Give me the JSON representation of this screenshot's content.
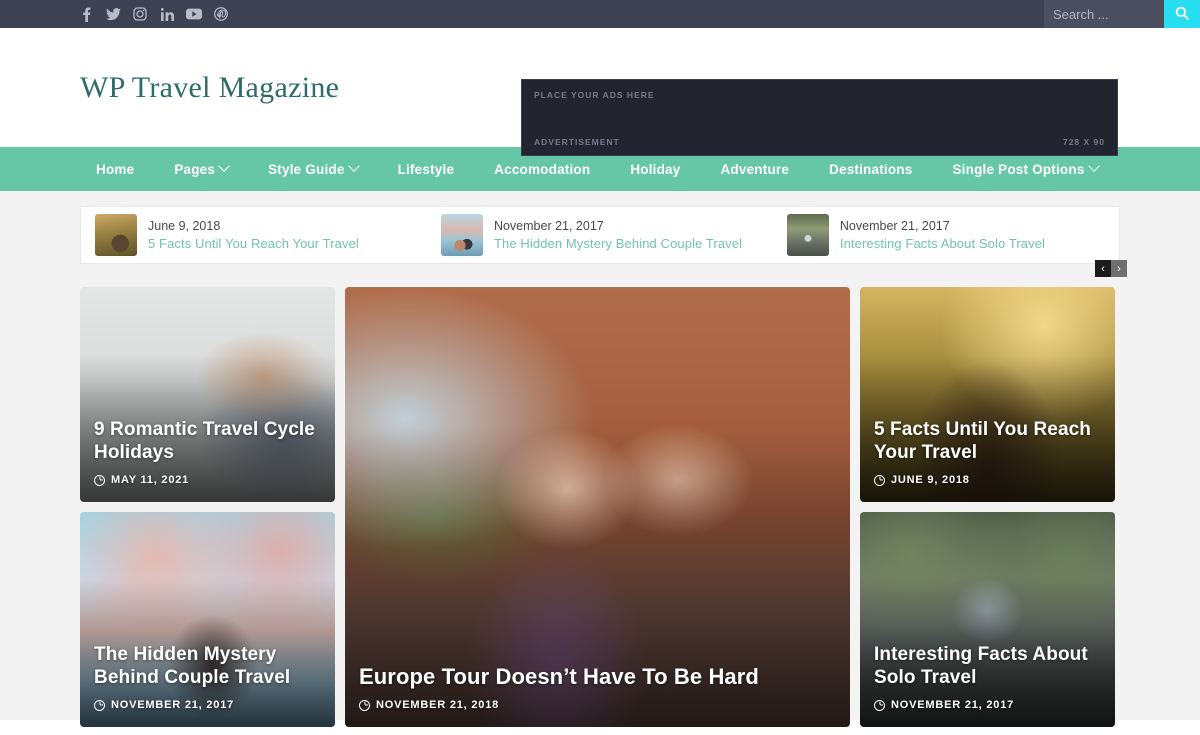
{
  "topbar": {
    "social": [
      {
        "name": "facebook-icon",
        "label": "Facebook"
      },
      {
        "name": "twitter-icon",
        "label": "Twitter"
      },
      {
        "name": "instagram-icon",
        "label": "Instagram"
      },
      {
        "name": "linkedin-icon",
        "label": "LinkedIn"
      },
      {
        "name": "youtube-icon",
        "label": "YouTube"
      },
      {
        "name": "pinterest-icon",
        "label": "Pinterest"
      }
    ],
    "search": {
      "placeholder": "Search ...",
      "value": "",
      "button_icon": "search-icon"
    },
    "background": "#3d4152",
    "search_button_color": "#27dff0"
  },
  "header": {
    "site_title": "WP Travel Magazine",
    "site_title_color": "#2e6b6a",
    "ad": {
      "top_label": "PLACE YOUR ADS HERE",
      "bottom_label": "ADVERTISEMENT",
      "size_label": "728 X 90"
    }
  },
  "nav": {
    "background": "#66c7a7",
    "items": [
      {
        "label": "Home",
        "has_dropdown": false
      },
      {
        "label": "Pages",
        "has_dropdown": true
      },
      {
        "label": "Style Guide",
        "has_dropdown": true
      },
      {
        "label": "Lifestyle",
        "has_dropdown": false
      },
      {
        "label": "Accomodation",
        "has_dropdown": false
      },
      {
        "label": "Holiday",
        "has_dropdown": false
      },
      {
        "label": "Adventure",
        "has_dropdown": false
      },
      {
        "label": "Destinations",
        "has_dropdown": false
      },
      {
        "label": "Single Post Options",
        "has_dropdown": true
      }
    ]
  },
  "ticker": {
    "items": [
      {
        "date": "June 9, 2018",
        "title": "5 Facts Until You Reach Your Travel"
      },
      {
        "date": "November 21, 2017",
        "title": "The Hidden Mystery Behind Couple Travel"
      },
      {
        "date": "November 21, 2017",
        "title": "Interesting Facts About Solo Travel"
      }
    ],
    "prev_label": "‹",
    "next_label": "›",
    "link_color": "#72c3ae"
  },
  "posts": {
    "top_left": {
      "title": "9 Romantic Travel Cycle Holidays",
      "date": "MAY 11, 2021"
    },
    "feature": {
      "title": "Europe Tour Doesn’t Have To Be Hard",
      "date": "NOVEMBER 21, 2018"
    },
    "top_right": {
      "title": "5 Facts Until You Reach Your Travel",
      "date": "JUNE 9, 2018"
    },
    "bottom_left": {
      "title": "The Hidden Mystery Behind Couple Travel",
      "date": "NOVEMBER 21, 2017"
    },
    "bottom_right": {
      "title": "Interesting Facts About Solo Travel",
      "date": "NOVEMBER 21, 2017"
    }
  }
}
